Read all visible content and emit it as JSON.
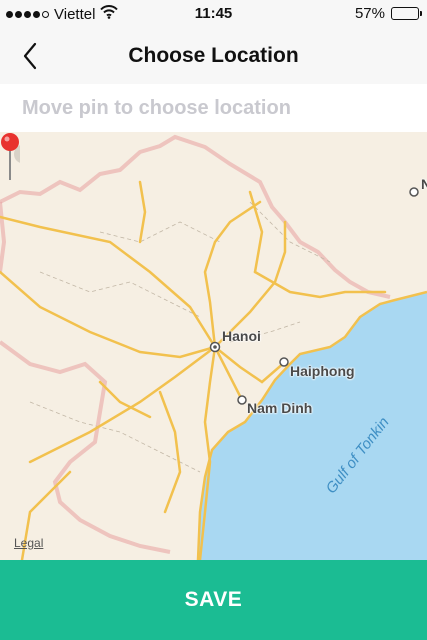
{
  "status_bar": {
    "carrier": "Viettel",
    "time": "11:45",
    "battery_percent": "57%",
    "battery_level": 0.57,
    "signal_bars_filled": 4,
    "signal_bars_total": 5,
    "icons": [
      "signal-dots-icon",
      "wifi-icon",
      "battery-icon"
    ]
  },
  "nav": {
    "title": "Choose Location",
    "back_icon": "chevron-left-icon"
  },
  "hint": {
    "text": "Move pin to choose location"
  },
  "map": {
    "labels": {
      "hanoi": "Hanoi",
      "haiphong": "Haiphong",
      "nam_dinh": "Nam Dinh",
      "gulf": "Gulf of Tonkin",
      "edge_partial": "N"
    },
    "legal": "Legal",
    "pin_icon": "map-pin-icon",
    "colors": {
      "land": "#f6efe3",
      "sea": "#a9d8f2",
      "roads": "#f2c14e",
      "border": "#e8a0a0",
      "pin": "#e8322e"
    }
  },
  "footer": {
    "save_label": "SAVE",
    "accent": "#1bbc93"
  }
}
